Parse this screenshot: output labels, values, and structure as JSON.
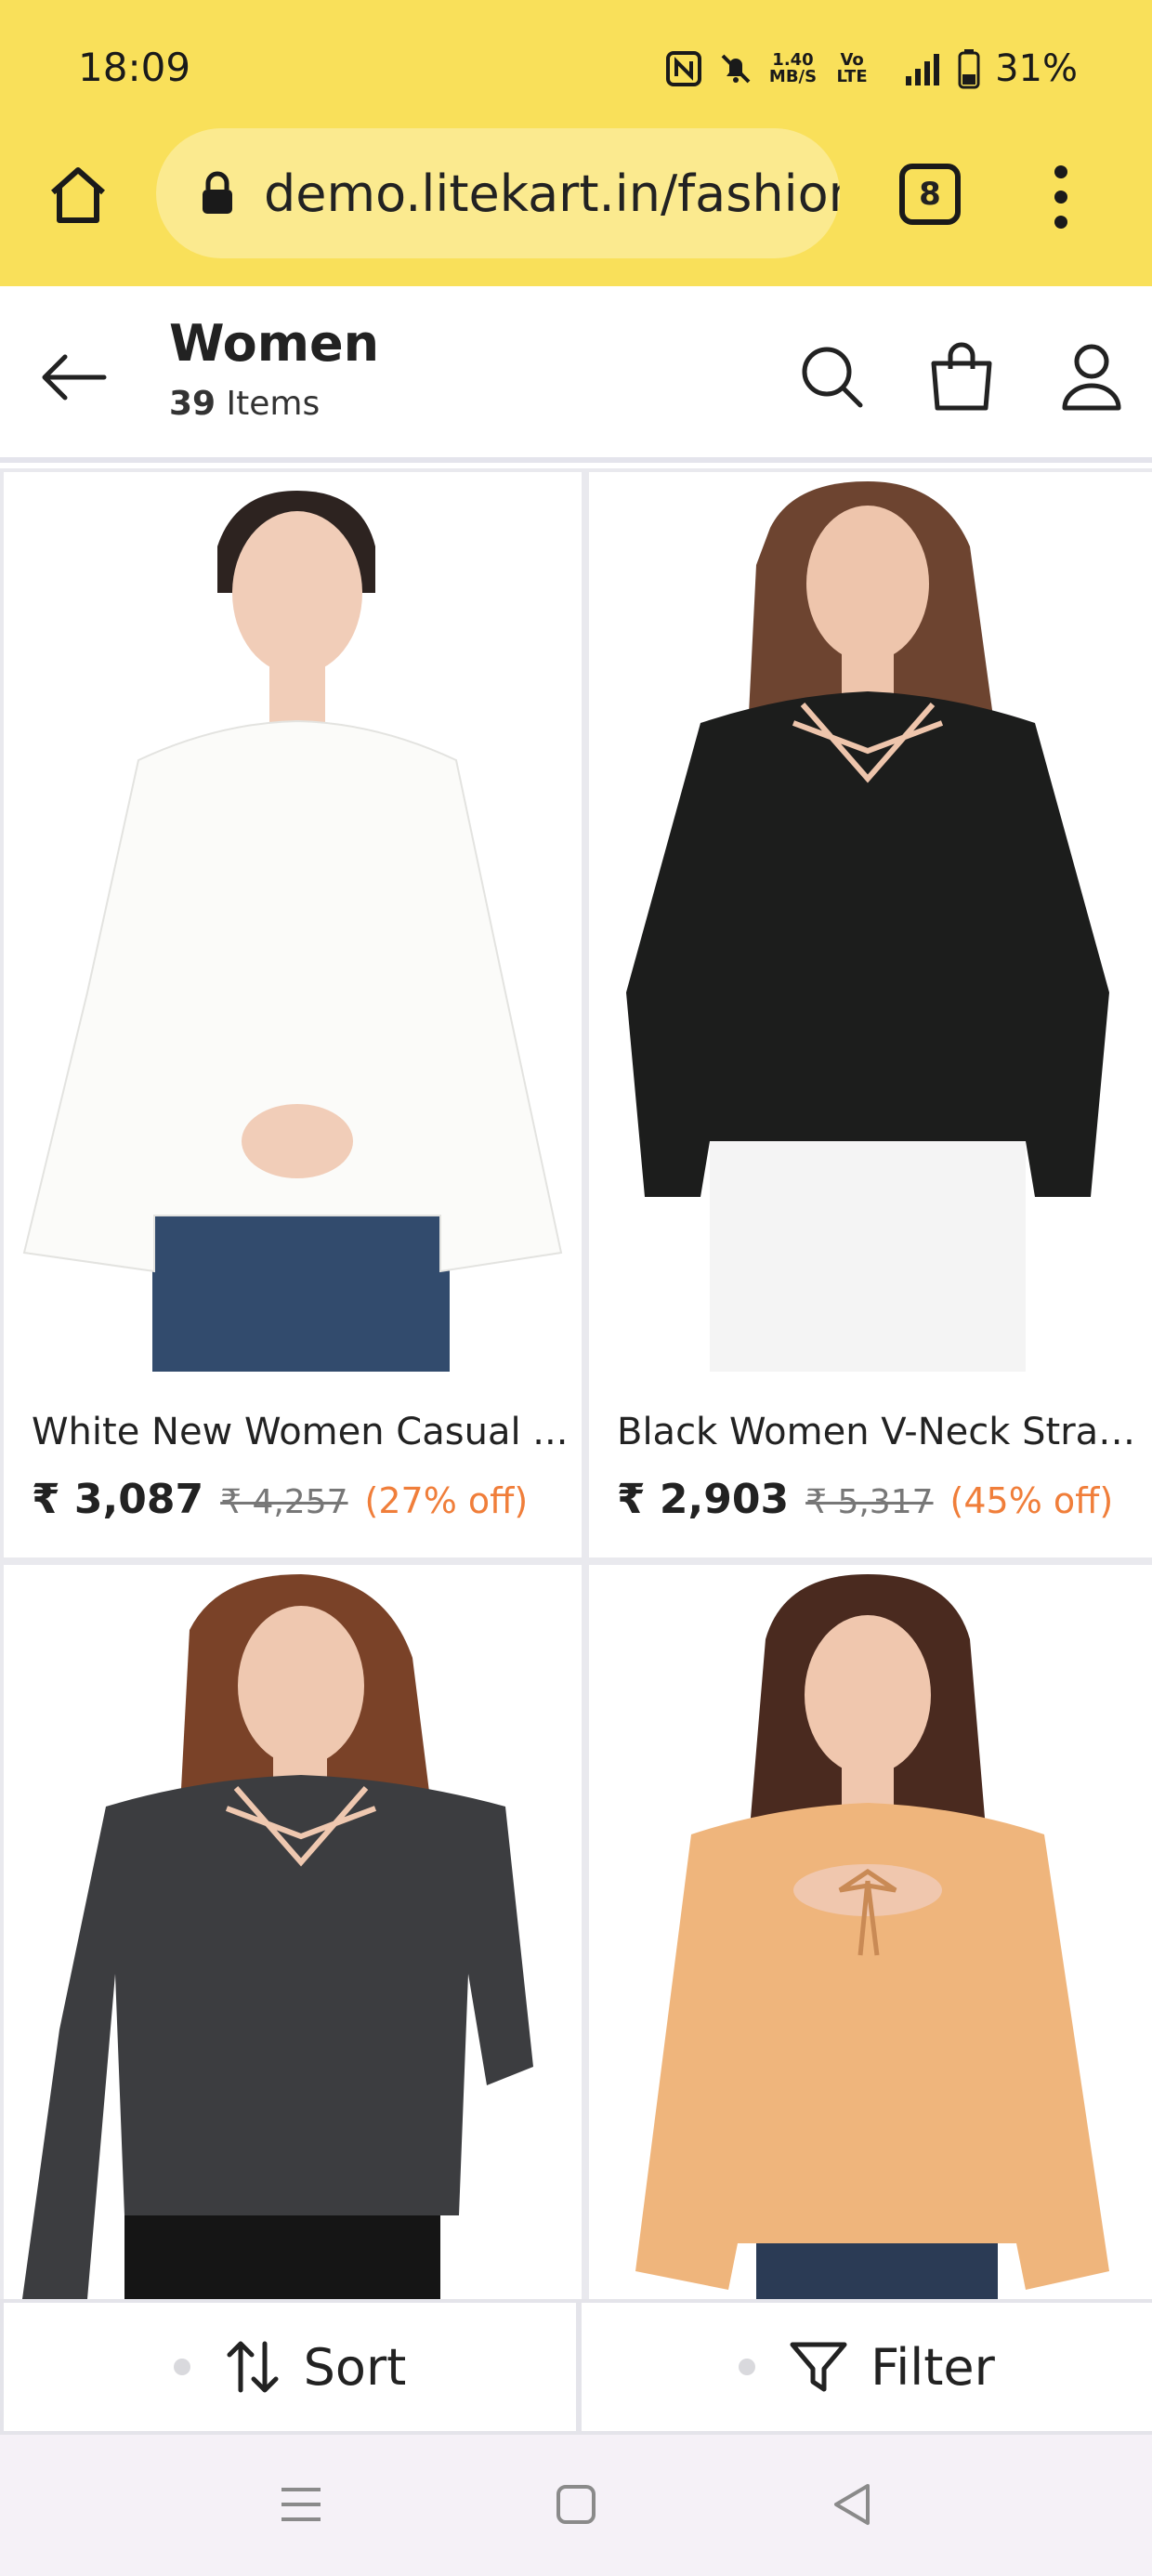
{
  "status_bar": {
    "time": "18:09",
    "net_speed_value": "1.40",
    "net_speed_unit": "MB/S",
    "volte": "Vo LTE",
    "network": "4G",
    "battery": "31%"
  },
  "browser": {
    "url": "demo.litekart.in/fashion",
    "tab_count": "8"
  },
  "header": {
    "title": "Women",
    "count": "39",
    "count_suffix": " Items"
  },
  "products": [
    {
      "name": "White New Women Casual ...",
      "price": "₹ 3,087",
      "mrp": "₹ 4,257",
      "discount": "(27% off)",
      "shirt_color": "#fbfbf9"
    },
    {
      "name": "Black Women V-Neck Strap...",
      "price": "₹ 2,903",
      "mrp": "₹ 5,317",
      "discount": "(45% off)",
      "shirt_color": "#1c1d1c"
    },
    {
      "name": "",
      "shirt_color": "#3c3d40"
    },
    {
      "name": "",
      "shirt_color": "#efb57c"
    }
  ],
  "actions": {
    "sort_label": "Sort",
    "filter_label": "Filter"
  },
  "colors": {
    "chrome_bg": "#f9e05a",
    "discount": "#f07e3a"
  }
}
